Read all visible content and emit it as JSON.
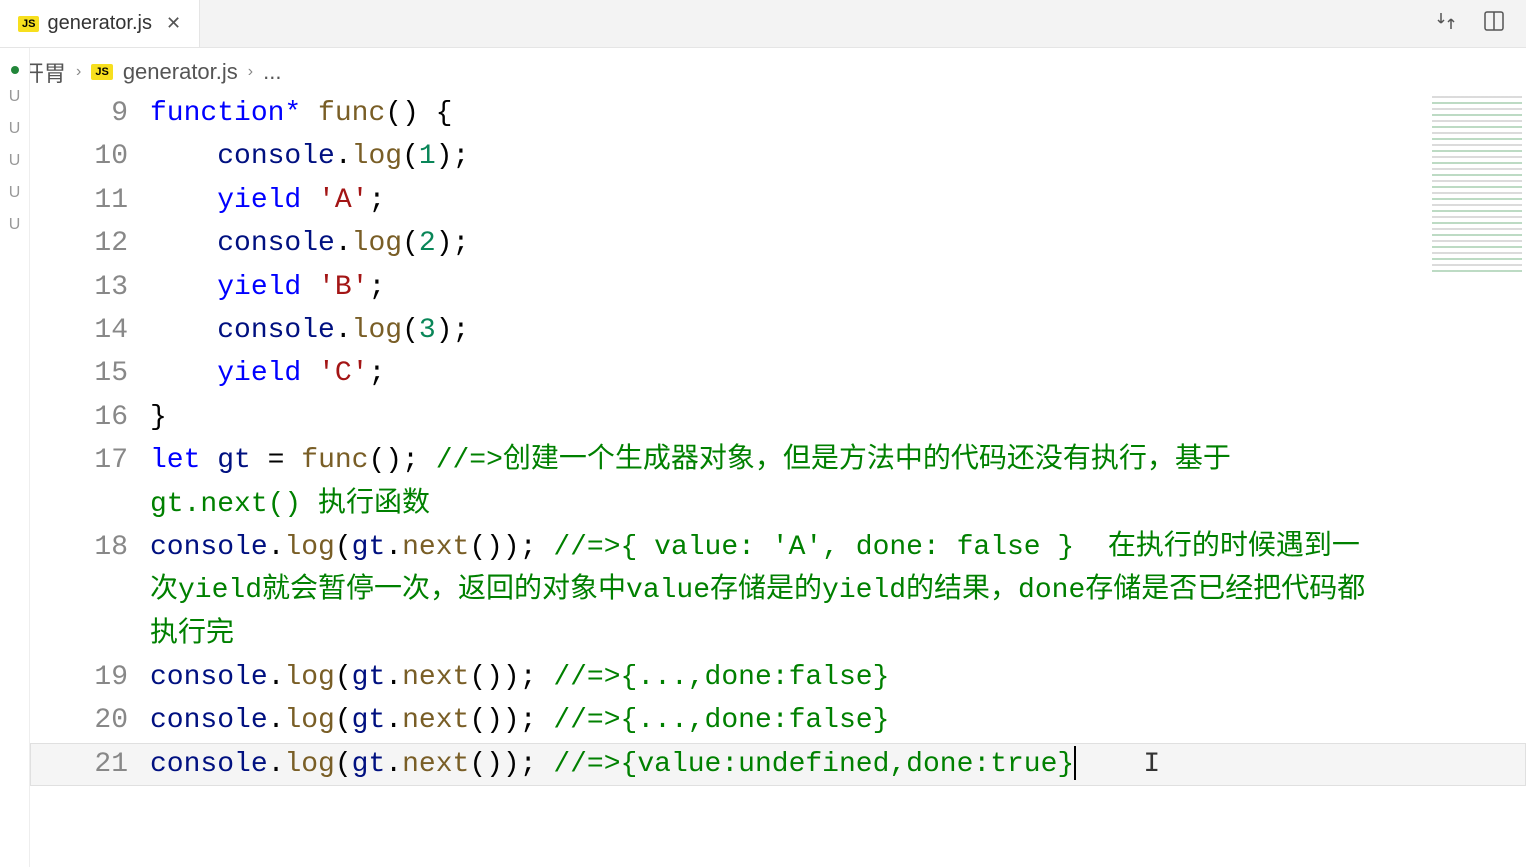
{
  "tab": {
    "icon_label": "JS",
    "filename": "generator.js"
  },
  "breadcrumb": {
    "root": "开胃",
    "file_icon": "JS",
    "filename": "generator.js",
    "more": "..."
  },
  "gutter_marks": [
    "U",
    "U",
    "U",
    "U",
    "U"
  ],
  "code_lines": [
    {
      "num": "9",
      "tokens": [
        {
          "cls": "tok-keyword",
          "t": "function*"
        },
        {
          "cls": "pale",
          "t": " "
        },
        {
          "cls": "tok-func",
          "t": "func"
        },
        {
          "cls": "pale",
          "t": "() {"
        }
      ]
    },
    {
      "num": "10",
      "indent": true,
      "tokens": [
        {
          "cls": "pale",
          "t": "    "
        },
        {
          "cls": "tok-var",
          "t": "console"
        },
        {
          "cls": "pale",
          "t": "."
        },
        {
          "cls": "tok-func",
          "t": "log"
        },
        {
          "cls": "pale",
          "t": "("
        },
        {
          "cls": "tok-num",
          "t": "1"
        },
        {
          "cls": "pale",
          "t": ");"
        }
      ]
    },
    {
      "num": "11",
      "indent": true,
      "tokens": [
        {
          "cls": "pale",
          "t": "    "
        },
        {
          "cls": "tok-keyword",
          "t": "yield"
        },
        {
          "cls": "pale",
          "t": " "
        },
        {
          "cls": "tok-string",
          "t": "'A'"
        },
        {
          "cls": "pale",
          "t": ";"
        }
      ]
    },
    {
      "num": "12",
      "indent": true,
      "tokens": [
        {
          "cls": "pale",
          "t": "    "
        },
        {
          "cls": "tok-var",
          "t": "console"
        },
        {
          "cls": "pale",
          "t": "."
        },
        {
          "cls": "tok-func",
          "t": "log"
        },
        {
          "cls": "pale",
          "t": "("
        },
        {
          "cls": "tok-num",
          "t": "2"
        },
        {
          "cls": "pale",
          "t": ");"
        }
      ]
    },
    {
      "num": "13",
      "indent": true,
      "tokens": [
        {
          "cls": "pale",
          "t": "    "
        },
        {
          "cls": "tok-keyword",
          "t": "yield"
        },
        {
          "cls": "pale",
          "t": " "
        },
        {
          "cls": "tok-string",
          "t": "'B'"
        },
        {
          "cls": "pale",
          "t": ";"
        }
      ]
    },
    {
      "num": "14",
      "indent": true,
      "tokens": [
        {
          "cls": "pale",
          "t": "    "
        },
        {
          "cls": "tok-var",
          "t": "console"
        },
        {
          "cls": "pale",
          "t": "."
        },
        {
          "cls": "tok-func",
          "t": "log"
        },
        {
          "cls": "pale",
          "t": "("
        },
        {
          "cls": "tok-num",
          "t": "3"
        },
        {
          "cls": "pale",
          "t": ");"
        }
      ]
    },
    {
      "num": "15",
      "indent": true,
      "tokens": [
        {
          "cls": "pale",
          "t": "    "
        },
        {
          "cls": "tok-keyword",
          "t": "yield"
        },
        {
          "cls": "pale",
          "t": " "
        },
        {
          "cls": "tok-string",
          "t": "'C'"
        },
        {
          "cls": "pale",
          "t": ";"
        }
      ]
    },
    {
      "num": "16",
      "tokens": [
        {
          "cls": "pale",
          "t": "}"
        }
      ]
    },
    {
      "num": "17",
      "tokens": [
        {
          "cls": "tok-keyword",
          "t": "let"
        },
        {
          "cls": "pale",
          "t": " "
        },
        {
          "cls": "tok-var",
          "t": "gt"
        },
        {
          "cls": "pale",
          "t": " = "
        },
        {
          "cls": "tok-func",
          "t": "func"
        },
        {
          "cls": "pale",
          "t": "(); "
        },
        {
          "cls": "tok-comment",
          "t": "//=>创建一个生成器对象，但是方法中的代码还没有执行，基于 gt.next() 执行函数"
        }
      ]
    },
    {
      "num": "18",
      "tokens": [
        {
          "cls": "tok-var",
          "t": "console"
        },
        {
          "cls": "pale",
          "t": "."
        },
        {
          "cls": "tok-func",
          "t": "log"
        },
        {
          "cls": "pale",
          "t": "("
        },
        {
          "cls": "tok-var",
          "t": "gt"
        },
        {
          "cls": "pale",
          "t": "."
        },
        {
          "cls": "tok-func",
          "t": "next"
        },
        {
          "cls": "pale",
          "t": "()); "
        },
        {
          "cls": "tok-comment",
          "t": "//=>{ value: 'A', done: false }  在执行的时候遇到一次yield就会暂停一次，返回的对象中value存储是的yield的结果，done存储是否已经把代码都执行完"
        }
      ]
    },
    {
      "num": "19",
      "tokens": [
        {
          "cls": "tok-var",
          "t": "console"
        },
        {
          "cls": "pale",
          "t": "."
        },
        {
          "cls": "tok-func",
          "t": "log"
        },
        {
          "cls": "pale",
          "t": "("
        },
        {
          "cls": "tok-var",
          "t": "gt"
        },
        {
          "cls": "pale",
          "t": "."
        },
        {
          "cls": "tok-func",
          "t": "next"
        },
        {
          "cls": "pale",
          "t": "()); "
        },
        {
          "cls": "tok-comment",
          "t": "//=>{...,done:false}"
        }
      ]
    },
    {
      "num": "20",
      "tokens": [
        {
          "cls": "tok-var",
          "t": "console"
        },
        {
          "cls": "pale",
          "t": "."
        },
        {
          "cls": "tok-func",
          "t": "log"
        },
        {
          "cls": "pale",
          "t": "("
        },
        {
          "cls": "tok-var",
          "t": "gt"
        },
        {
          "cls": "pale",
          "t": "."
        },
        {
          "cls": "tok-func",
          "t": "next"
        },
        {
          "cls": "pale",
          "t": "()); "
        },
        {
          "cls": "tok-comment",
          "t": "//=>{...,done:false}"
        }
      ]
    },
    {
      "num": "21",
      "active": true,
      "cursor": true,
      "tokens": [
        {
          "cls": "tok-var",
          "t": "console"
        },
        {
          "cls": "pale",
          "t": "."
        },
        {
          "cls": "tok-func",
          "t": "log"
        },
        {
          "cls": "pale",
          "t": "("
        },
        {
          "cls": "tok-var",
          "t": "gt"
        },
        {
          "cls": "pale",
          "t": "."
        },
        {
          "cls": "tok-func",
          "t": "next"
        },
        {
          "cls": "pale",
          "t": "()); "
        },
        {
          "cls": "tok-comment",
          "t": "//=>{value:undefined,done:true}"
        }
      ]
    }
  ]
}
